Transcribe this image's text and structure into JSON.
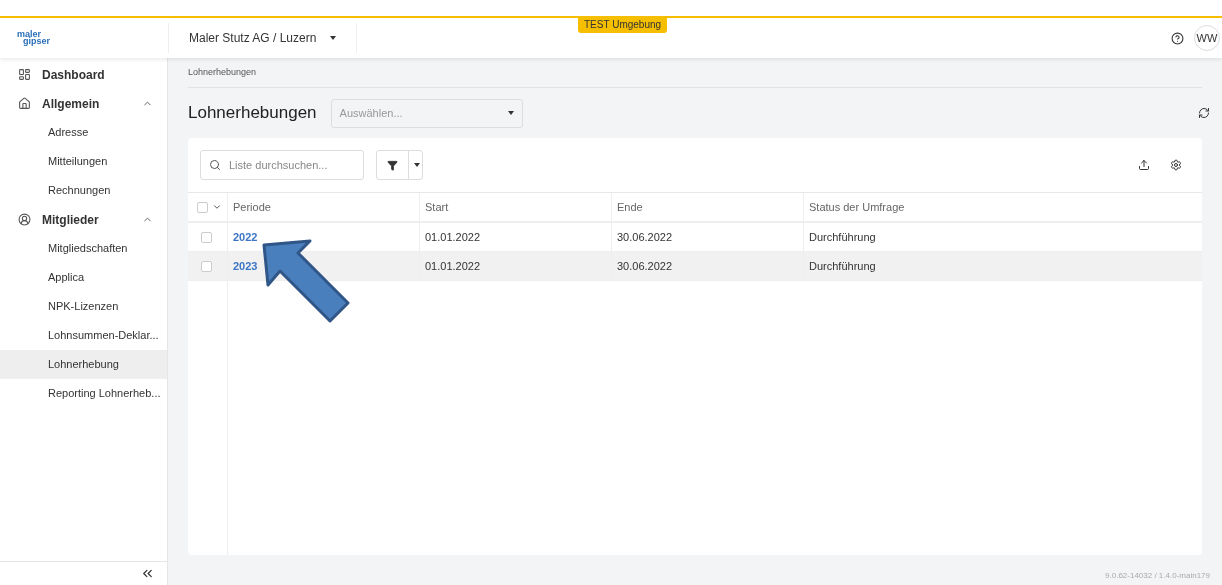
{
  "env_badge": "TEST Umgebung",
  "logo": {
    "line_1": "maler",
    "line_2": "gipser"
  },
  "header": {
    "organization": "Maler Stutz AG / Luzern",
    "user_initials": "WW"
  },
  "sidebar": {
    "items": [
      {
        "label": "Dashboard",
        "selected": false
      },
      {
        "label": "Allgemein",
        "expanded": true,
        "children": [
          {
            "label": "Adresse",
            "selected": false
          },
          {
            "label": "Mitteilungen",
            "selected": false
          },
          {
            "label": "Rechnungen",
            "selected": false
          }
        ]
      },
      {
        "label": "Mitglieder",
        "expanded": true,
        "children": [
          {
            "label": "Mitgliedschaften",
            "selected": false
          },
          {
            "label": "Applica",
            "selected": false
          },
          {
            "label": "NPK-Lizenzen",
            "selected": false
          },
          {
            "label": "Lohnsummen-Deklar...",
            "selected": false
          },
          {
            "label": "Lohnerhebung",
            "selected": true
          },
          {
            "label": "Reporting Lohnerheb...",
            "selected": false
          }
        ]
      }
    ]
  },
  "breadcrumb": "Lohnerhebungen",
  "page": {
    "title": "Lohnerhebungen",
    "select_placeholder": "Auswählen..."
  },
  "search": {
    "placeholder": "Liste durchsuchen..."
  },
  "table": {
    "all_checked": false,
    "columns": [
      "Periode",
      "Start",
      "Ende",
      "Status der Umfrage"
    ],
    "rows": [
      {
        "selected": false,
        "checked": false,
        "cells": [
          "2022",
          "01.01.2022",
          "30.06.2022",
          "Durchführung"
        ]
      },
      {
        "selected": true,
        "checked": false,
        "cells": [
          "2023",
          "01.01.2022",
          "30.06.2022",
          "Durchführung"
        ]
      }
    ]
  },
  "version": "9.0.62-14032 / 1.4.0-main179"
}
